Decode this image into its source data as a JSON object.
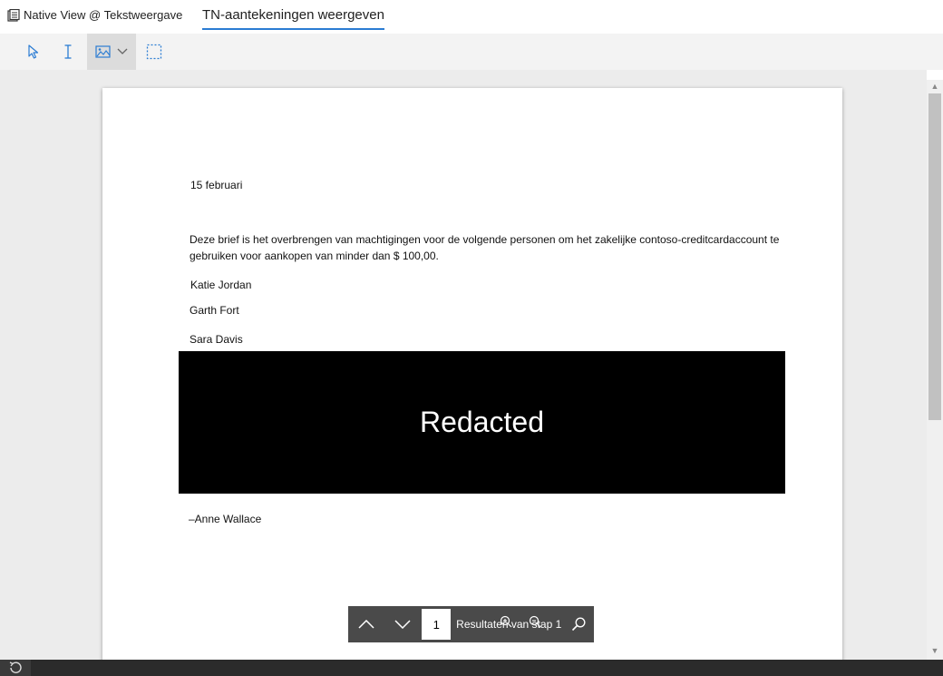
{
  "tabs": {
    "native_view": "Native View @ Tekstweergave",
    "annotations": "TN-aantekeningen weergeven"
  },
  "toolbar": {
    "tools": [
      "pointer-icon",
      "text-cursor-icon",
      "image-redact-icon",
      "chevron-down-icon",
      "area-select-icon"
    ],
    "active_tool": "image-redact-icon"
  },
  "document": {
    "date": "15 februari",
    "body_line1": "Deze brief is het overbrengen van machtigingen voor de volgende personen om het zakelijke contoso-creditcardaccount te",
    "body_line2": "gebruiken voor aankopen van minder dan $ 100,00.",
    "names": [
      "Katie Jordan",
      "Garth Fort",
      "Sara Davis"
    ],
    "redacted_label": "Redacted",
    "signature": "–Anne Wallace"
  },
  "findbar": {
    "page_value": "1",
    "results_label": "Resultaten van stap 1"
  },
  "colors": {
    "accent": "#2b7cd3",
    "redaction": "#000000",
    "findbar_bg": "#4a4a4a"
  }
}
